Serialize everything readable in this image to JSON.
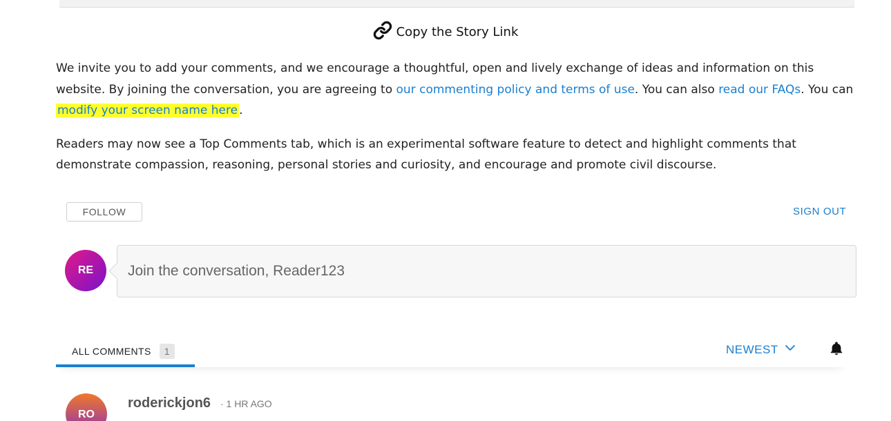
{
  "copy_link": {
    "label": "Copy the Story Link",
    "icon": "link-icon"
  },
  "intro": {
    "p1_text1": "We invite you to add your comments, and we encourage a thoughtful, open and lively exchange of ideas and information on this website. By joining the conversation, you are agreeing to ",
    "p1_link1": "our commenting policy and terms of use",
    "p1_text2": ". You can also ",
    "p1_link2": "read our FAQs",
    "p1_text3": ". You can ",
    "p1_link3": "modify your screen name here",
    "p1_text4": ".",
    "p2": "Readers may now see a Top Comments tab, which is an experimental software feature to detect and highlight comments that demonstrate compassion, reasoning, personal stories and curiosity, and encourage and promote civil discourse."
  },
  "actions": {
    "follow": "FOLLOW",
    "sign_out": "SIGN OUT"
  },
  "composer": {
    "avatar_initials": "RE",
    "placeholder": "Join the conversation, Reader123"
  },
  "tabs": {
    "all_comments": "ALL COMMENTS",
    "count": "1",
    "sort_label": "NEWEST"
  },
  "comments": [
    {
      "avatar_initials": "RO",
      "author": "roderickjon6",
      "time": "· 1 HR AGO"
    }
  ],
  "colors": {
    "link": "#1a7fd0",
    "highlight": "#ffff2e",
    "tab_underline": "#1a7fd0"
  }
}
